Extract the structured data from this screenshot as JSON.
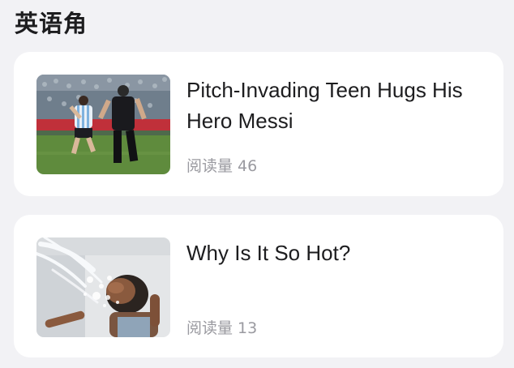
{
  "section": {
    "title": "英语角"
  },
  "articles": [
    {
      "headline": "Pitch-Invading Teen Hugs His Hero Messi",
      "read_label": "阅读量",
      "read_count": "46",
      "thumbnail_icon": "soccer-pitch-image"
    },
    {
      "headline": "Why Is It So Hot?",
      "read_label": "阅读量",
      "read_count": "13",
      "thumbnail_icon": "water-splash-image"
    }
  ],
  "colors": {
    "page_background": "#f2f2f5",
    "card_background": "#ffffff",
    "headline": "#1d1d1f",
    "meta": "#9a9aa0"
  }
}
